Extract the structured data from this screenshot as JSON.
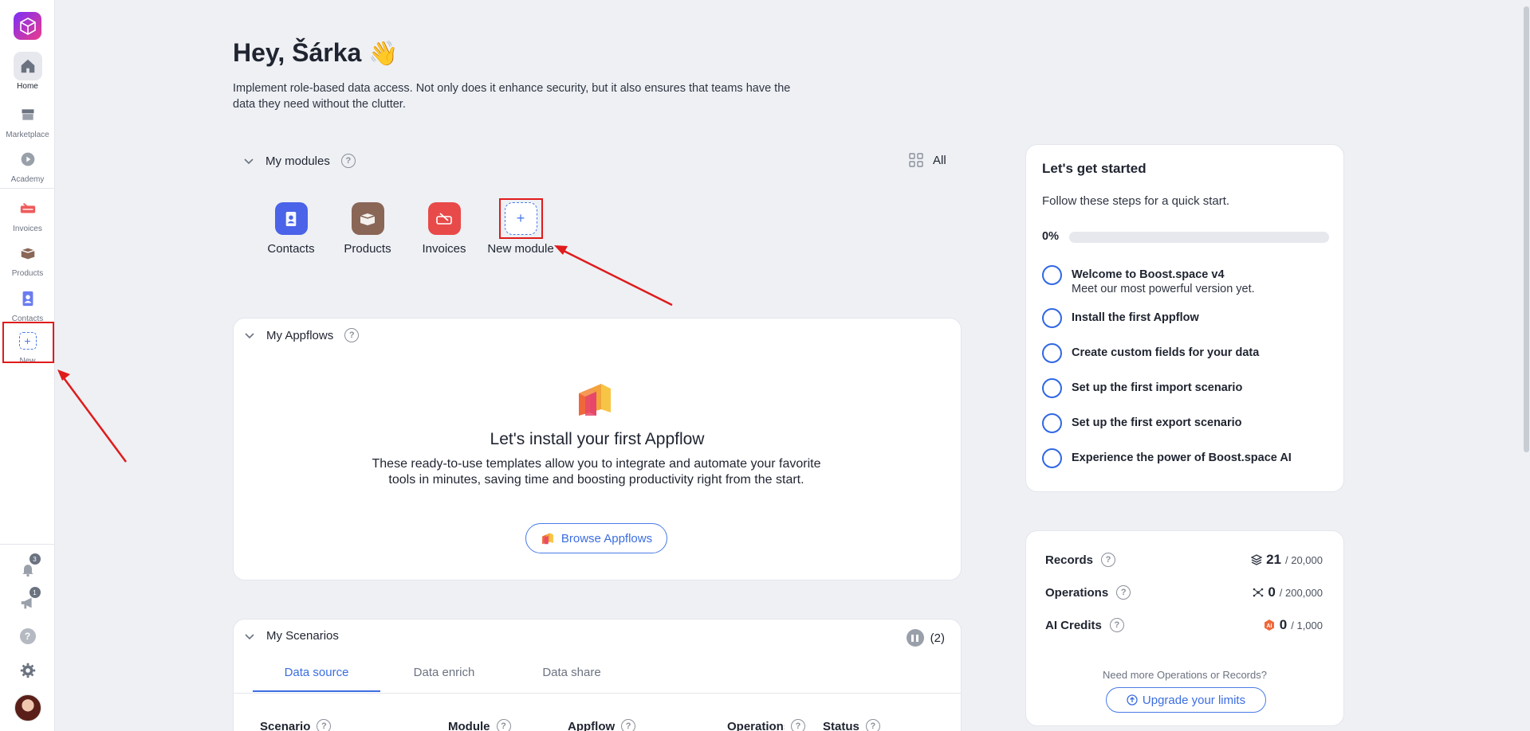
{
  "sidebar": {
    "items": [
      {
        "label": "Home",
        "icon": "home-icon"
      },
      {
        "label": "Marketplace",
        "icon": "store-icon"
      },
      {
        "label": "Academy",
        "icon": "play-icon"
      },
      {
        "label": "Invoices",
        "icon": "invoice-icon"
      },
      {
        "label": "Products",
        "icon": "box-icon"
      },
      {
        "label": "Contacts",
        "icon": "contact-icon"
      },
      {
        "label": "New",
        "icon": "plus-icon"
      }
    ],
    "notifications_badge": "3",
    "announcements_badge": "1"
  },
  "greeting": {
    "title": "Hey, Šárka",
    "emoji": "👋",
    "description": "Implement role-based data access. Not only does it enhance security, but it also ensures that teams have the data they need without the clutter."
  },
  "modules": {
    "title": "My modules",
    "all_label": "All",
    "items": [
      {
        "label": "Contacts",
        "color": "#4a63e8"
      },
      {
        "label": "Products",
        "color": "#8a6656"
      },
      {
        "label": "Invoices",
        "color": "#e84a4a"
      },
      {
        "label": "New module",
        "color": "#4a7be8"
      }
    ]
  },
  "appflows": {
    "title": "My Appflows",
    "install_title": "Let's install your first Appflow",
    "install_desc": "These ready-to-use templates allow you to integrate and automate your favorite tools in minutes, saving time and boosting productivity right from the start.",
    "browse_label": "Browse Appflows"
  },
  "scenarios": {
    "title": "My Scenarios",
    "count": "(2)",
    "tabs": [
      "Data source",
      "Data enrich",
      "Data share"
    ],
    "active_tab": "Data source",
    "columns": [
      "Scenario",
      "Module",
      "Appflow",
      "Operations",
      "Status"
    ]
  },
  "getting_started": {
    "title": "Let's get started",
    "subtitle": "Follow these steps for a quick start.",
    "progress_label": "0%",
    "progress": 0,
    "steps": [
      {
        "title": "Welcome to Boost.space v4",
        "subtitle": "Meet our most powerful version yet."
      },
      {
        "title": "Install the first Appflow"
      },
      {
        "title": "Create custom fields for your data"
      },
      {
        "title": "Set up the first import scenario"
      },
      {
        "title": "Set up the first export scenario"
      },
      {
        "title": "Experience the power of Boost.space AI"
      }
    ]
  },
  "usage": {
    "rows": [
      {
        "label": "Records",
        "value": "21",
        "limit": "/ 20,000",
        "icon": "layers-icon"
      },
      {
        "label": "Operations",
        "value": "0",
        "limit": "/ 200,000",
        "icon": "network-icon"
      },
      {
        "label": "AI Credits",
        "value": "0",
        "limit": "/ 1,000",
        "icon": "ai-credit-icon"
      }
    ],
    "need_more": "Need more Operations or Records?",
    "upgrade_label": "Upgrade your limits"
  },
  "colors": {
    "accent": "#3b6de0",
    "highlight": "#e01b1b",
    "background": "#eef0f4"
  }
}
